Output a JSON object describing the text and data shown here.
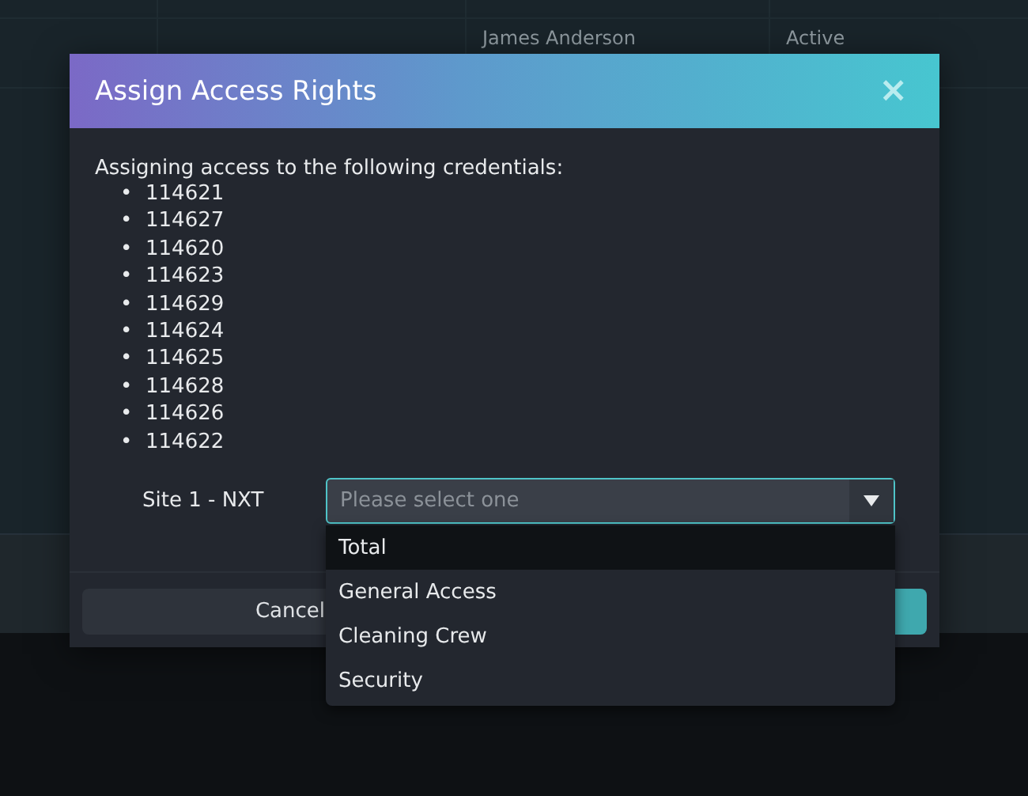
{
  "background_table": {
    "rows": [
      {
        "column_3": "James Anderson",
        "column_4": "Active"
      }
    ]
  },
  "dialog": {
    "title": "Assign Access Rights",
    "close": "×",
    "intro": "Assigning access to the following credentials:",
    "bullet": "•",
    "credentials": [
      "114621",
      "114627",
      "114620",
      "114623",
      "114629",
      "114624",
      "114625",
      "114628",
      "114626",
      "114622"
    ],
    "site_label": "Site 1 - NXT",
    "select": {
      "placeholder": "Please select one",
      "expanded": true,
      "options": [
        {
          "label": "Total",
          "highlighted": true
        },
        {
          "label": "General Access",
          "highlighted": false
        },
        {
          "label": "Cleaning Crew",
          "highlighted": false
        },
        {
          "label": "Security",
          "highlighted": false
        }
      ]
    },
    "buttons": [
      {
        "kind": "secondary",
        "label": "Cancel"
      },
      {
        "kind": "primary"
      }
    ]
  }
}
